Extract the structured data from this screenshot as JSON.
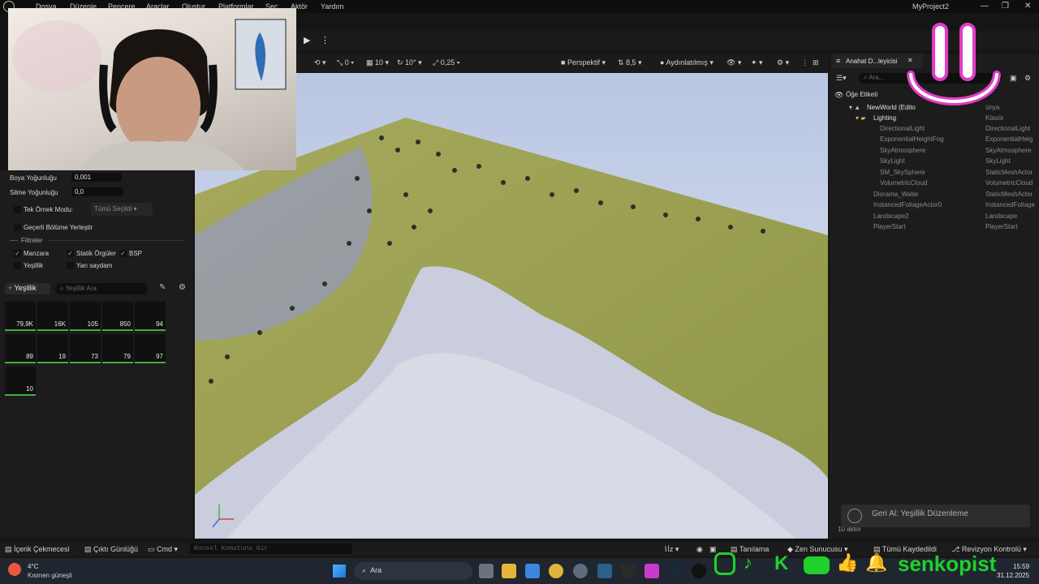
{
  "menu": {
    "items": [
      "Dosya",
      "Düzenle",
      "Pencere",
      "Araçlar",
      "Oluştur",
      "Platformlar",
      "Seç",
      "Aktör",
      "Yardım"
    ],
    "project": "MyProject2"
  },
  "viewport_toolbar": {
    "snap_translate": "0",
    "snap_grid": "10",
    "snap_rotate": "10°",
    "snap_scale": "0,25",
    "perspective": "Perspektif",
    "camera_speed": "8,5",
    "lighting": "Aydınlatılmış"
  },
  "foliage_panel": {
    "paint_density_label": "Boya Yoğunluğu",
    "paint_density_value": "0,001",
    "erase_density_label": "Silme Yoğunluğu",
    "erase_density_value": "0,0",
    "single_instance_label": "Tek Örnek Modu:",
    "single_instance_value": "Tümü Seçildi",
    "place_in_current_level": "Geçerli Bölüme Yerleştir",
    "filters_label": "Filtreler",
    "filters": [
      {
        "label": "Manzara",
        "checked": true
      },
      {
        "label": "Statik Örgüler",
        "checked": true
      },
      {
        "label": "BSP",
        "checked": true
      },
      {
        "label": "Yeşillik",
        "checked": false
      },
      {
        "label": "Yarı saydam",
        "checked": false
      }
    ],
    "add_button": "Yeşillik",
    "search_placeholder": "Yeşillik Ara",
    "tiles": [
      "79,9K",
      "16K",
      "105",
      "850",
      "94",
      "89",
      "19",
      "73",
      "79",
      "97",
      "10"
    ]
  },
  "outliner": {
    "tab_title": "Anahat D...leyicisi",
    "search_placeholder": "Ara...",
    "column_label": "Öğe Etiketi",
    "column_type_partial": "ünya",
    "rows": [
      {
        "name": "NewWorld (Edito",
        "type": "ünya",
        "indent": 0,
        "dim": false
      },
      {
        "name": "Lighting",
        "type": "Klasör",
        "indent": 1,
        "dim": false
      },
      {
        "name": "DirectionalLight",
        "type": "DirectionalLight",
        "indent": 2,
        "dim": true
      },
      {
        "name": "ExponentialHeightFog",
        "type": "ExponentialHeig",
        "indent": 2,
        "dim": true
      },
      {
        "name": "SkyAtmosphere",
        "type": "SkyAtmosphere",
        "indent": 2,
        "dim": true
      },
      {
        "name": "SkyLight",
        "type": "SkyLight",
        "indent": 2,
        "dim": true
      },
      {
        "name": "SM_SkySphere",
        "type": "StaticMeshActor",
        "indent": 2,
        "dim": true
      },
      {
        "name": "VolumetricCloud",
        "type": "VolumetricCloud",
        "indent": 2,
        "dim": true
      },
      {
        "name": "Diorama_Water",
        "type": "StaticMeshActor",
        "indent": 1,
        "dim": true
      },
      {
        "name": "InstancedFoliageActor0",
        "type": "InstancedFoliage",
        "indent": 1,
        "dim": true
      },
      {
        "name": "Landscape2",
        "type": "Landscape",
        "indent": 1,
        "dim": true
      },
      {
        "name": "PlayerStart",
        "type": "PlayerStart",
        "indent": 1,
        "dim": true
      }
    ],
    "actor_count": "10 aktör"
  },
  "toast": "Geri Al: Yeşillik Düzenleme",
  "bottom_bar": {
    "content_drawer": "İçerik Çekmecesi",
    "output_log": "Çıktı Günlüğü",
    "cmd": "Cmd",
    "console_placeholder": "Konsol Komutunu Gir",
    "trace": "İz",
    "derived_data": "Tanılama",
    "zen_server": "Zen Sunucusu",
    "save_all": "Tümü Kaydedildi",
    "revision_control": "Revizyon Kontrolü"
  },
  "taskbar": {
    "weather_temp": "4°C",
    "weather_desc": "Kısmen güneşli",
    "search_label": "Ara",
    "time": "15:59",
    "date": "31.12.2025"
  },
  "overlay": {
    "handle": "senkopist"
  }
}
